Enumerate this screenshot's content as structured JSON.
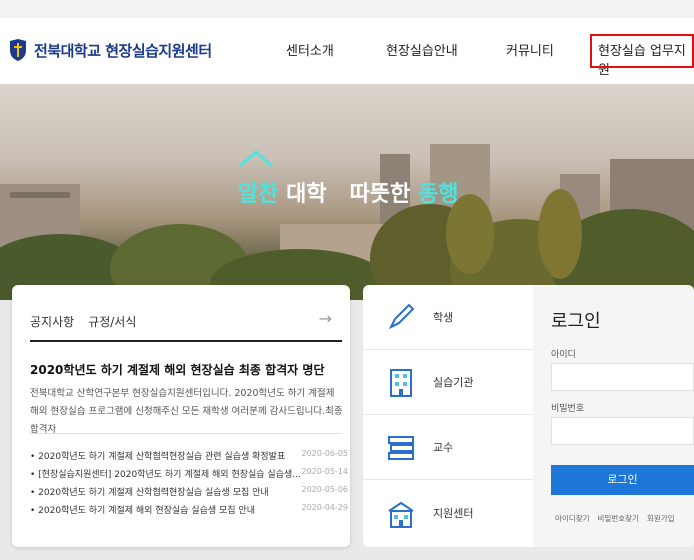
{
  "header": {
    "logo_text": "전북대학교 현장실습지원센터",
    "nav": [
      "센터소개",
      "현장실습안내",
      "커뮤니티",
      "현장실습 업무지원"
    ]
  },
  "hero": {
    "slogan_a": "알찬",
    "slogan_b": "대학",
    "slogan_c": "따뜻한",
    "slogan_d": "동행"
  },
  "notice": {
    "tabs": [
      "공지사항",
      "규정/서식"
    ],
    "arrow": "→",
    "headline": "2020학년도 하기 계절제 해외 현장실습 최종 합격자 명단",
    "headline_body": "전북대학교 산학연구본부 현장실습지원센터입니다. 2020학년도 하기 계절제 해외 현장실습 프로그램에 신청해주신 모든 재학생 여러분께 감사드립니다.최종 합격자",
    "items": [
      {
        "title": "• 2020학년도 하기 계절제 산학협력현장실습 관련 실습생 확정발표",
        "date": "2020-06-05"
      },
      {
        "title": "• [현장실습지원센터] 2020학년도 하기 계절제 해외 현장실습 실습생...",
        "date": "2020-05-14"
      },
      {
        "title": "• 2020학년도 하기 계절제 산학협력현장실습 실습생 모집 안내",
        "date": "2020-05-06"
      },
      {
        "title": "• 2020학년도 하기 계절제 해외 현장실습 실습생 모집 안내",
        "date": "2020-04-29"
      }
    ]
  },
  "quick": {
    "items": [
      {
        "label": "학생",
        "icon": "pencil-icon"
      },
      {
        "label": "실습기관",
        "icon": "building-icon"
      },
      {
        "label": "교수",
        "icon": "books-icon"
      },
      {
        "label": "지원센터",
        "icon": "school-icon"
      }
    ]
  },
  "login": {
    "title": "로그인",
    "id_label": "아이디",
    "pw_label": "비밀번호",
    "button": "로그인",
    "links": [
      "아이디찾기",
      "비밀번호찾기",
      "회원가입"
    ]
  },
  "colors": {
    "brand": "#1b3a8c",
    "accent": "#4fe3e0",
    "login_button": "#1e76d8",
    "highlight_box": "#e01010"
  }
}
